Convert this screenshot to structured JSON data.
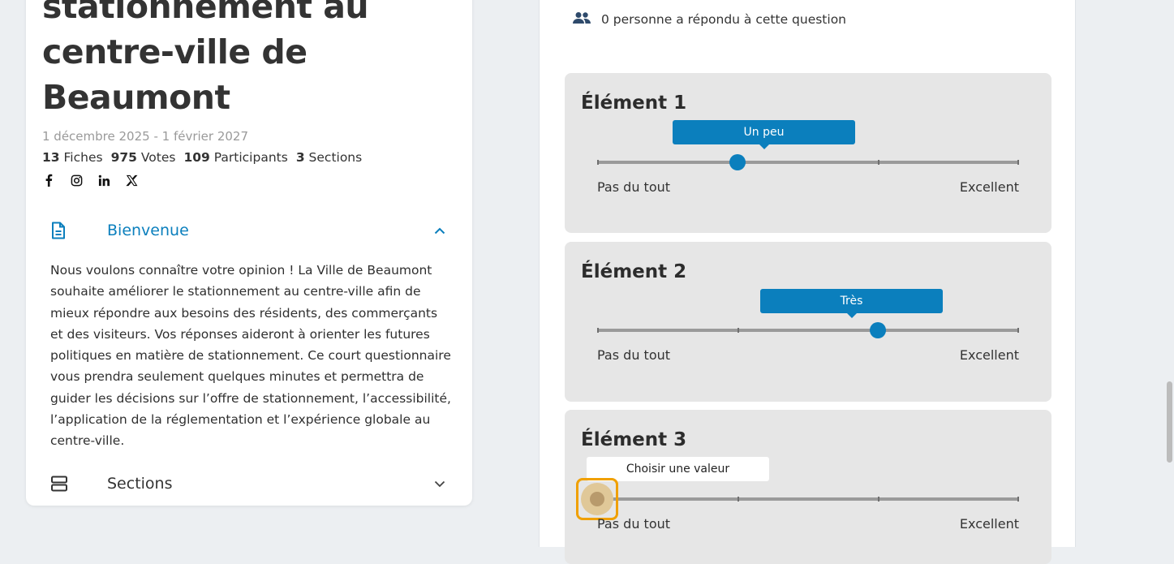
{
  "project": {
    "title": "stationnement au centre-ville de Beaumont",
    "dates": "1 décembre 2025 - 1 février 2027",
    "stats": [
      {
        "num": "13",
        "label": "Fiches"
      },
      {
        "num": "975",
        "label": "Votes"
      },
      {
        "num": "109",
        "label": "Participants"
      },
      {
        "num": "3",
        "label": "Sections"
      }
    ],
    "socials": [
      "facebook-icon",
      "instagram-icon",
      "linkedin-icon",
      "x-icon"
    ]
  },
  "accordion": {
    "welcome_label": "Bienvenue",
    "welcome_text": "Nous voulons connaître votre opinion ! La Ville de Beaumont souhaite améliorer le stationnement au centre-ville afin de mieux répondre aux besoins des résidents, des commerçants et des visiteurs. Vos réponses aideront à orienter les futures politiques en matière de stationnement. Ce court questionnaire vous prendra seulement quelques minutes et permettra de guider les décisions sur l’offre de stationnement, l’accessibilité, l’application de la réglementation et l’expérience globale au centre-ville.",
    "sections_label": "Sections"
  },
  "question": {
    "responded": "0 personne a répondu à cette question"
  },
  "items": [
    {
      "title": "Élément 1",
      "tooltip": "Un peu",
      "level": 1,
      "min": "Pas du tout",
      "max": "Excellent"
    },
    {
      "title": "Élément 2",
      "tooltip": "Très",
      "level": 2,
      "min": "Pas du tout",
      "max": "Excellent"
    },
    {
      "title": "Élément 3",
      "tooltip": "Choisir une valeur",
      "level": null,
      "min": "Pas du tout",
      "max": "Excellent"
    }
  ],
  "colors": {
    "accent": "#0b7fbd",
    "focus": "#f0a000",
    "card": "#e6e6e6"
  }
}
